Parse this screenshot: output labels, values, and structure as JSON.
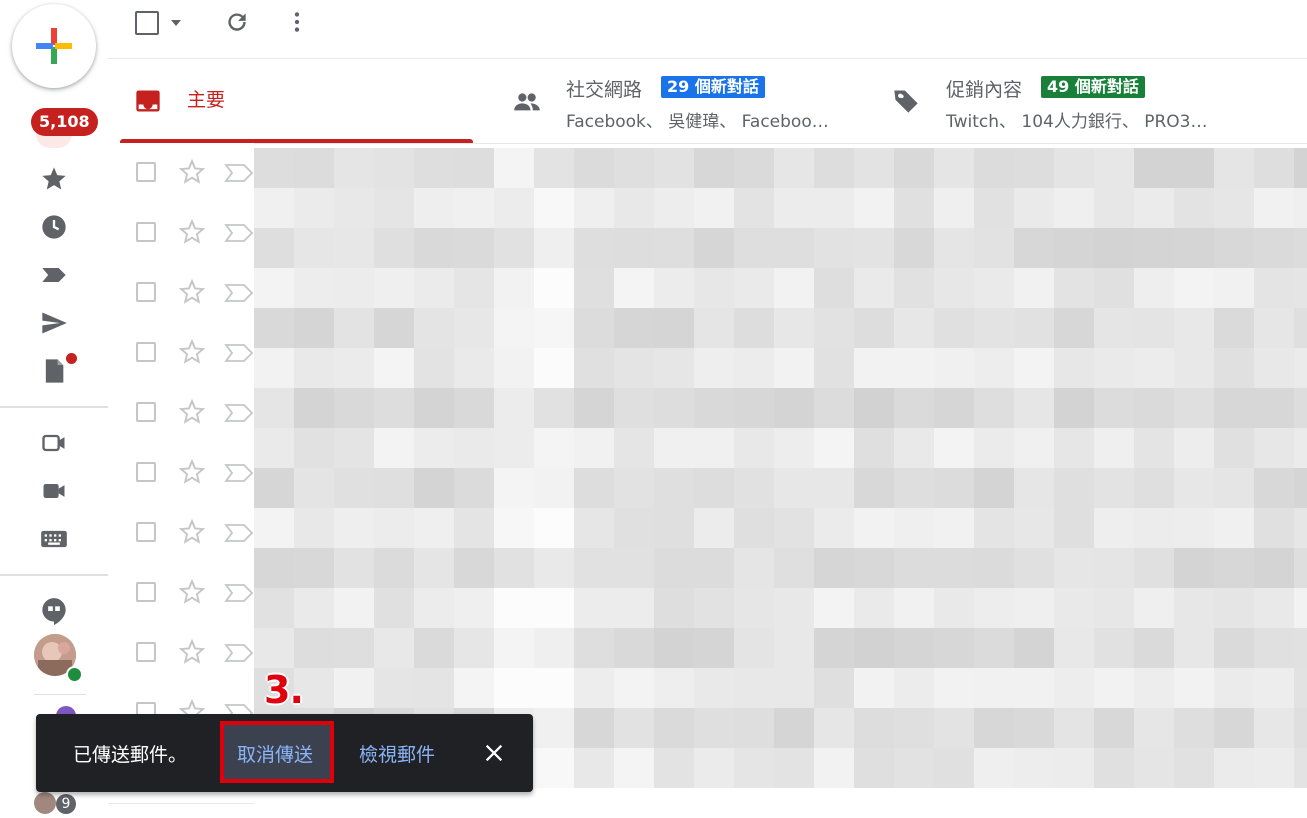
{
  "sidebar": {
    "unread_count": "5,108",
    "chat_badge": "9",
    "icons": [
      "compose-plus-icon",
      "inbox-icon",
      "starred-icon",
      "snoozed-icon",
      "important-icon",
      "sent-icon",
      "drafts-icon",
      "meet-new-icon",
      "meet-join-icon",
      "keyboard-icon",
      "hangouts-icon",
      "avatar",
      "avatar-2",
      "avatar-3"
    ]
  },
  "toolbar": {
    "icons": [
      "select-checkbox",
      "select-dropdown-icon",
      "refresh-icon",
      "more-vert-icon"
    ]
  },
  "tabs": [
    {
      "label": "主要",
      "active": true,
      "color": "#c5221f"
    },
    {
      "label": "社交網路",
      "badge": "29 個新對話",
      "badge_color": "#1a73e8",
      "sub": "Facebook、 吳健瑋、 Faceboo…"
    },
    {
      "label": "促銷內容",
      "badge": "49 個新對話",
      "badge_color": "#188038",
      "sub": "Twitch、 104人力銀行、 PRO3…"
    }
  ],
  "snackbar": {
    "message": "已傳送郵件。",
    "undo": "取消傳送",
    "view": "檢視郵件"
  },
  "annotation": {
    "step": "3."
  },
  "colors": {
    "accent_red": "#c5221f",
    "highlight_box": "#e0000d",
    "link_blue": "#8ab4f8"
  }
}
